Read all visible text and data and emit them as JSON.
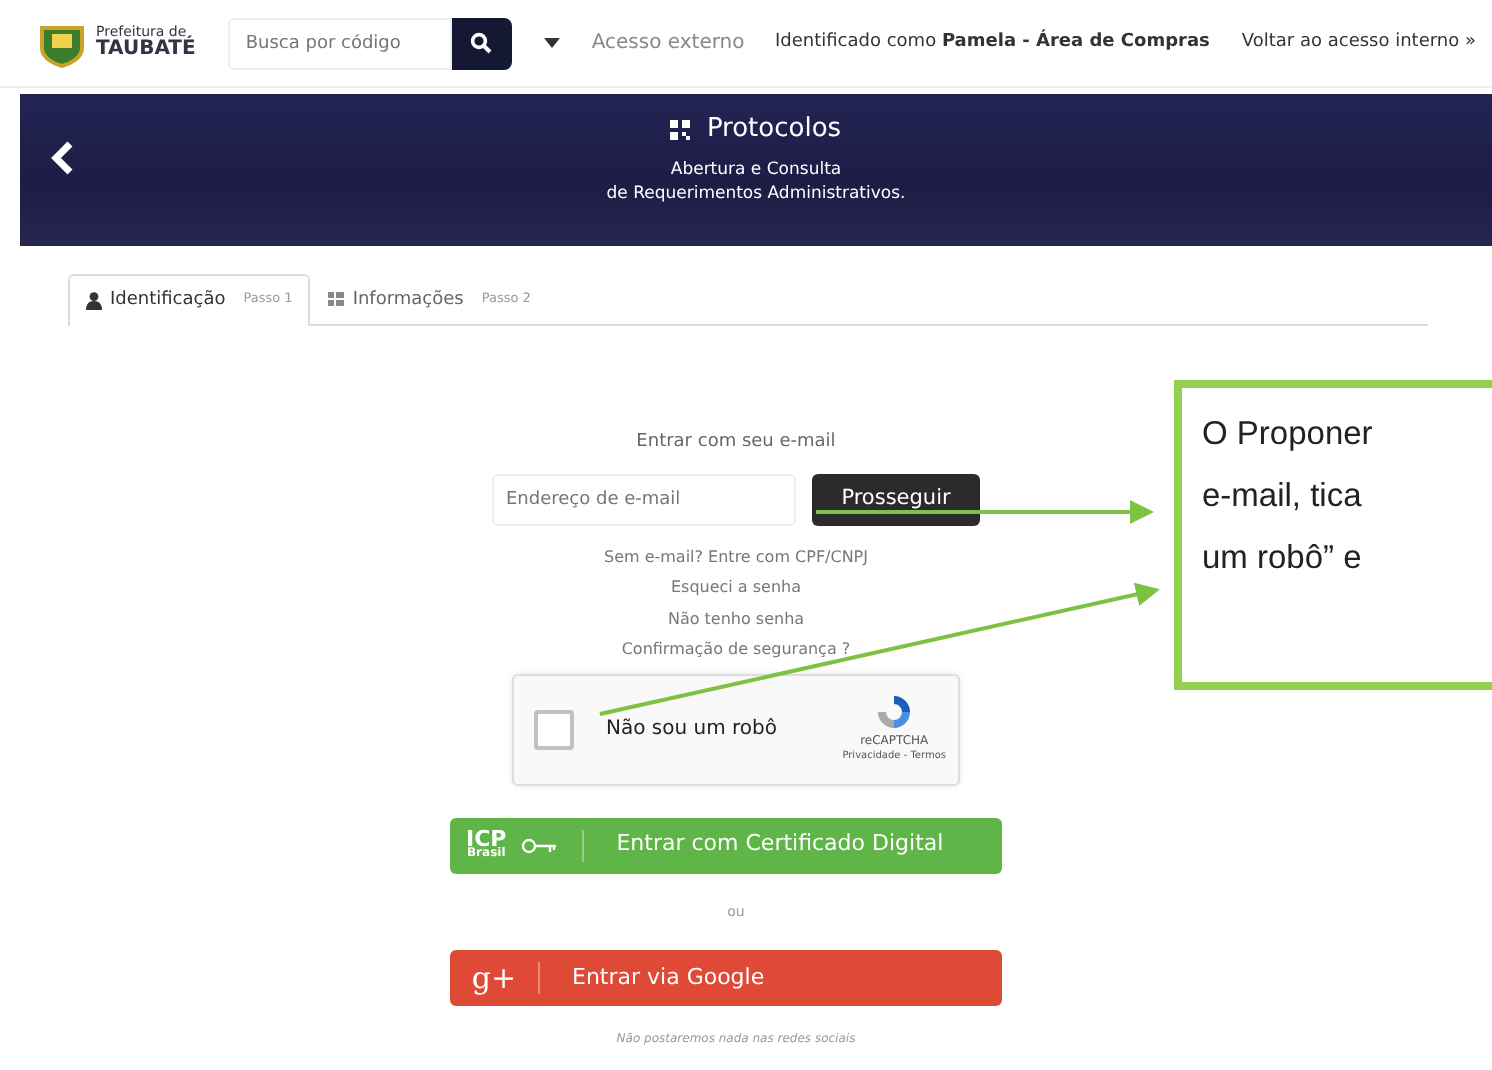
{
  "header": {
    "logo_lines": [
      "Prefeitura de",
      "TAUBATÉ"
    ],
    "search": {
      "placeholder": "Busca por código"
    },
    "external_link": "Acesso externo",
    "identity": "Identificado como **Pamela - Área de Compras**",
    "back_link": "Voltar ao acesso interno »"
  },
  "banner": {
    "title": "Protocolos",
    "subtitle_lines": [
      "Abertura e Consulta",
      "de Requerimentos Administrativos."
    ]
  },
  "tabs": [
    {
      "label": "Identificação",
      "step": "Passo 1",
      "selected": true
    },
    {
      "label": "Informações",
      "step": "Passo 2",
      "selected": false
    }
  ],
  "login": {
    "heading": "Entrar com seu e-mail",
    "email": {
      "placeholder": "Endereço de e-mail"
    },
    "submit": "Prosseguir",
    "links": [
      "Sem e-mail? Entre com CPF/CNPJ",
      "Esqueci a senha",
      "Não tenho senha",
      "Confirmação de segurança ?"
    ],
    "captcha": {
      "label": "Não sou um robô",
      "checked": false,
      "brand": "reCAPTCHA",
      "terms": "Privacidade - Termos"
    },
    "certificate_button": {
      "logo": "ICP",
      "logo_sub": "Brasil",
      "label": "Entrar com Certificado Digital"
    },
    "separator": "ou",
    "google_button": {
      "logo": "g+",
      "label": "Entrar via Google"
    },
    "note": "Não postaremos nada nas redes sociais"
  },
  "callout": {
    "lines": [
      "O Proponer",
      "e-mail, tica",
      "um robô” e"
    ]
  }
}
